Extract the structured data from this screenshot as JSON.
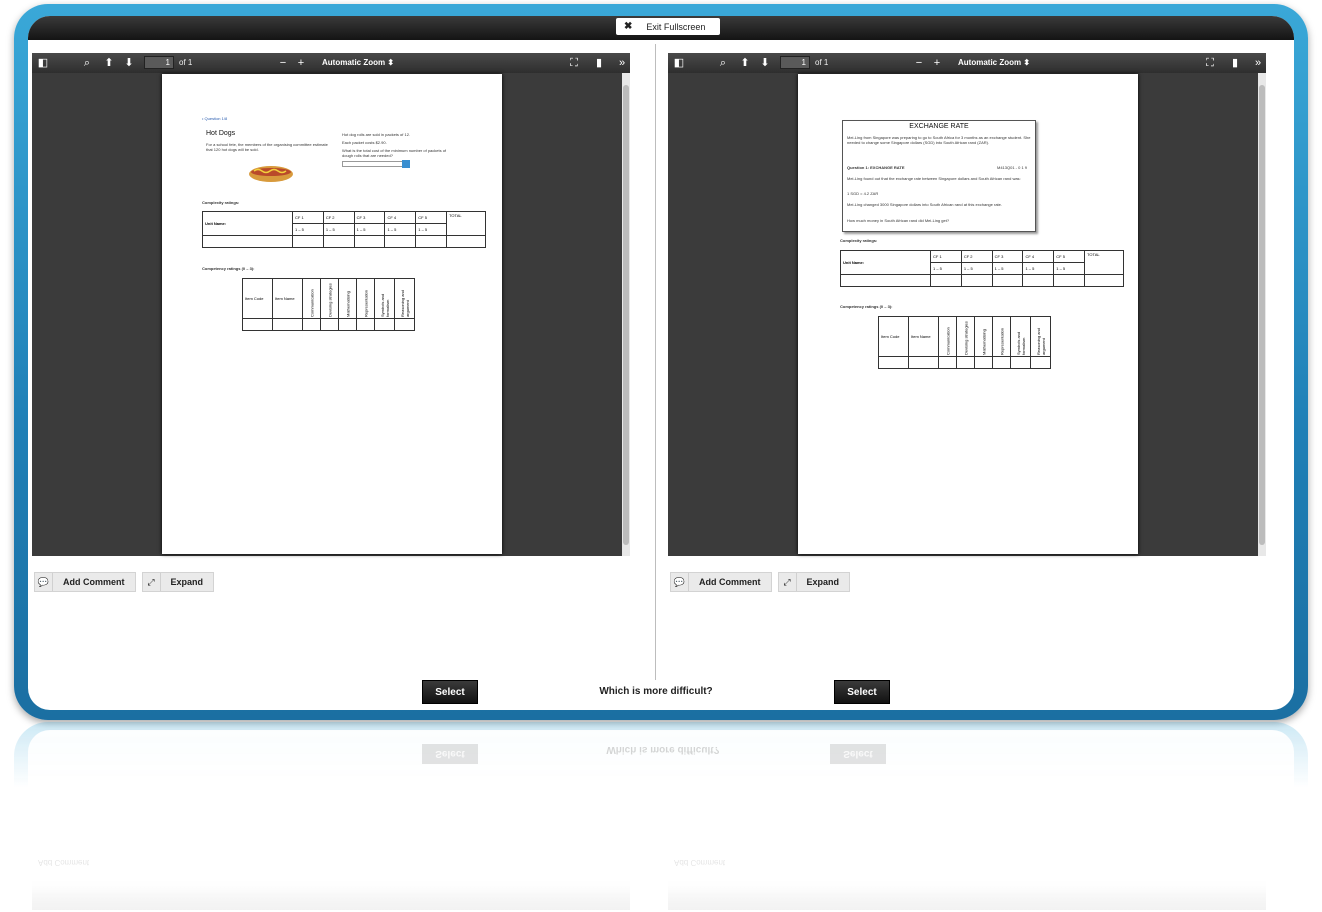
{
  "topbar": {
    "exit_fullscreen_label": "Exit Fullscreen",
    "close_glyph": "✖"
  },
  "viewers": [
    {
      "page_number": "1",
      "page_total": "of 1",
      "zoom": "Automatic Zoom",
      "doc": {
        "link": "• Question 1/8",
        "title": "Hot Dogs",
        "para1": "For a school fete, the members of the organising committee estimate that 120 hot dogs will be sold.",
        "para2": "Hot dog rolls are sold in packets of 12.",
        "para3": "Each packet costs $2.90.",
        "para4": "What is the total cost of the minimum number of packets of dough rolls that are needed?",
        "complexity_label": "Complexity ratings:",
        "competency_label": "Competency ratings (0 – 3):"
      }
    },
    {
      "page_number": "1",
      "page_total": "of 1",
      "zoom": "Automatic Zoom",
      "doc": {
        "title": "EXCHANGE RATE",
        "intro": "Mei-Ling from Singapore was preparing to go to South Africa for 3 months as an exchange student. She needed to change some Singapore dollars (SGD) into South African rand (ZAR).",
        "question": "Question 1: EXCHANGE RATE",
        "q_code": "M413Q01 - 0 1 9",
        "q_text": "Mei-Ling found out that the exchange rate between Singapore dollars and South African rand was:",
        "rate": "1 SGD = 4.2 ZAR",
        "q_text2": "Mei-Ling changed 3000 Singapore dollars into South African rand at this exchange rate.",
        "q_text3": "How much money in South African rand did Mei-Ling get?",
        "complexity_label": "Complexity ratings:",
        "competency_label": "Competency ratings (0 – 3):"
      }
    }
  ],
  "rating_table": {
    "headers": [
      "CF 1",
      "CF 2",
      "CF 3",
      "CF 4",
      "CF 5",
      "TOTAL"
    ],
    "row_label": "Unit Name:",
    "range": "1 – 5"
  },
  "competency_table": {
    "headers": [
      "Item Code",
      "Item Name",
      "Communication",
      "Devising strategies",
      "Mathematising",
      "Representation",
      "Symbols and formalism",
      "Reasoning and argument"
    ]
  },
  "actions": {
    "add_comment": "Add Comment",
    "expand": "Expand"
  },
  "selection": {
    "select_label": "Select",
    "question": "Which is more difficult?"
  },
  "colors": {
    "frame": "#2a93c9",
    "toolbar": "#3b3b3b"
  }
}
